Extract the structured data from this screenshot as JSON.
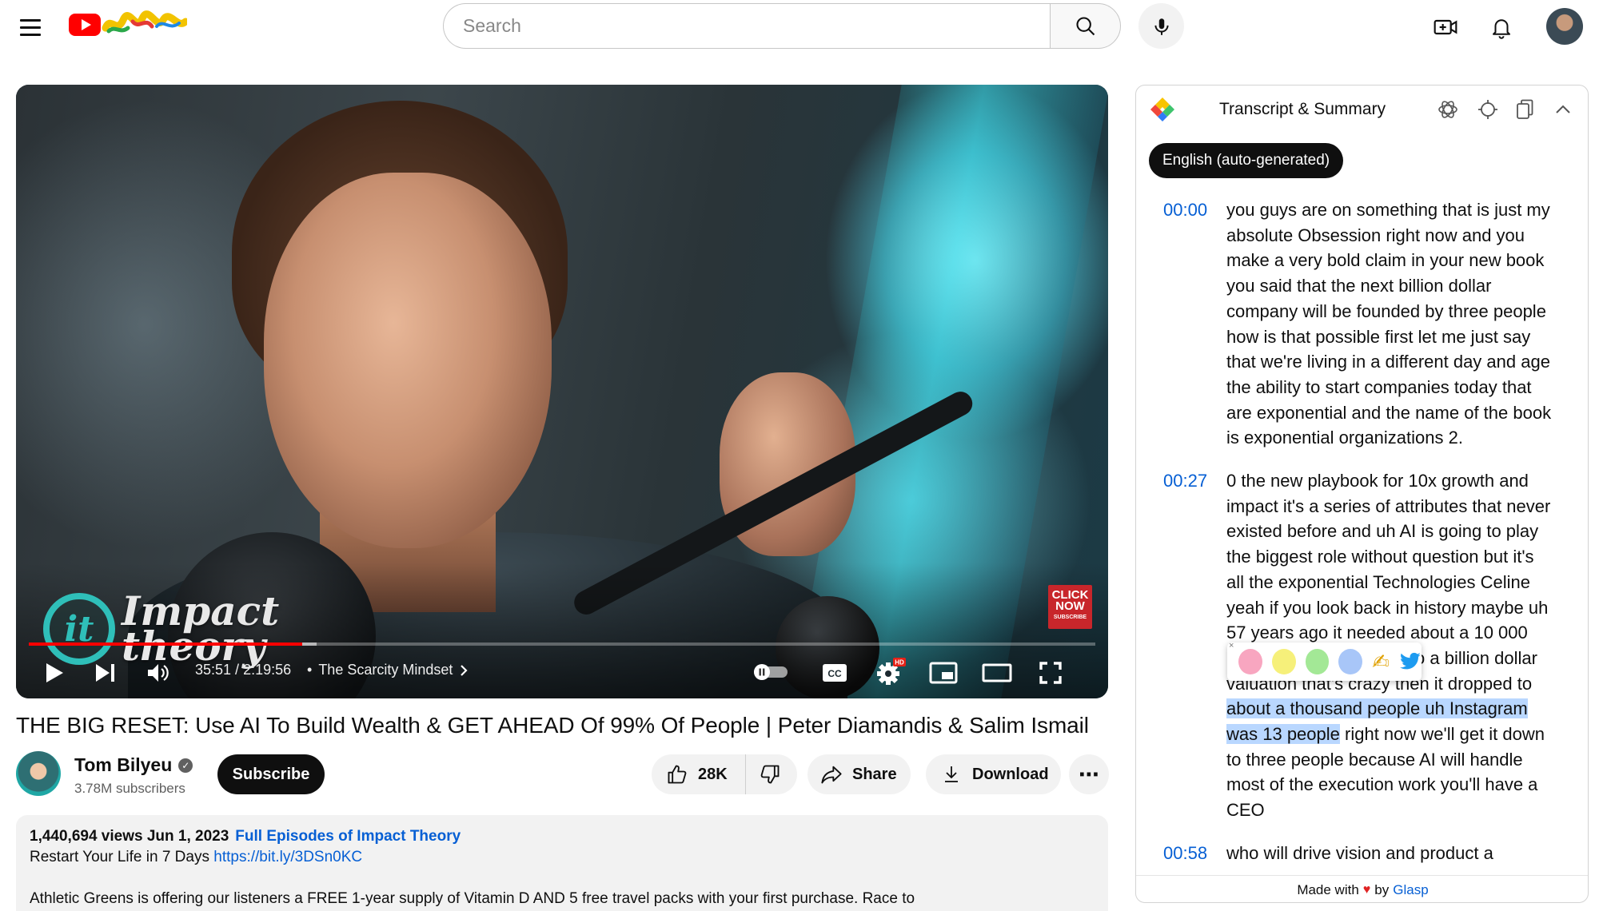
{
  "masthead": {
    "search_placeholder": "Search"
  },
  "player": {
    "current_time": "35:51",
    "time_separator": " / ",
    "duration": "2:19:56",
    "chapter_separator": "•",
    "chapter": "The Scarcity Mindset",
    "progress_played_fraction": 0.256,
    "progress_buffered_fraction": 0.27,
    "watermark_text_line1": "Impact",
    "watermark_text_line2": "theory",
    "watermark_logo_text": "it",
    "click_now_line1": "CLICK",
    "click_now_line2": "NOW",
    "click_now_sub": "SUBSCRIBE",
    "cc_label": "CC",
    "hd_badge": "HD"
  },
  "video": {
    "title": "THE BIG RESET: Use AI To Build Wealth & GET AHEAD Of 99% Of People | Peter Diamandis & Salim Ismail",
    "channel_name": "Tom Bilyeu",
    "verified_mark": "✓",
    "subscribers": "3.78M subscribers",
    "subscribe_label": "Subscribe",
    "likes": "28K",
    "share_label": "Share",
    "download_label": "Download",
    "more_label": "⋯"
  },
  "description": {
    "views_date": "1,440,694 views  Jun 1, 2023",
    "playlist_link": "Full Episodes of Impact Theory",
    "line2_text": "Restart Your Life in 7 Days ",
    "line2_link": "https://bit.ly/3DSn0KC",
    "line3_text": "Athletic Greens is offering our listeners a FREE 1-year supply of Vitamin D AND 5 free travel packs with your first purchase. Race to"
  },
  "panel": {
    "title": "Transcript & Summary",
    "language_chip": "English (auto-generated)",
    "segments": [
      {
        "time": "00:00",
        "text": "you guys are on something that is just my\nabsolute Obsession right now and you\nmake a very bold claim in your new book\nyou said that the next billion dollar\ncompany will be founded by three people\nhow is that possible first let me just say\nthat we're living in a different day and age\nthe ability to start companies today that\nare exponential and the name of the book\nis exponential organizations 2."
      },
      {
        "time": "00:27",
        "text_before": "0 the new playbook for 10x growth and\nimpact it's a series of attributes that never\nexisted before and uh AI is going to play\nthe biggest role without question but it's\nall the exponential Technologies Celine\nyeah if you look back in history maybe uh\n57 years ago it needed about a 10 000\nperson company to get to a billion dollar\nvaluation that's crazy then it dropped to\n",
        "text_highlighted": "about a thousand people uh Instagram\nwas 13 people",
        "text_after": " right now we'll get it down\nto three people because AI will handle\nmost of the execution work you'll have a\nCEO"
      },
      {
        "time": "00:58",
        "text": "who will drive vision and product a"
      }
    ],
    "footer_before": "Made with",
    "footer_heart": "♥",
    "footer_by": "by",
    "footer_link": "Glasp"
  },
  "highlighter": {
    "close_mark": "×",
    "colors": [
      "#f8a6c0",
      "#f6f07a",
      "#a3e896",
      "#a8c6f8"
    ],
    "pen_icon": "✍"
  }
}
